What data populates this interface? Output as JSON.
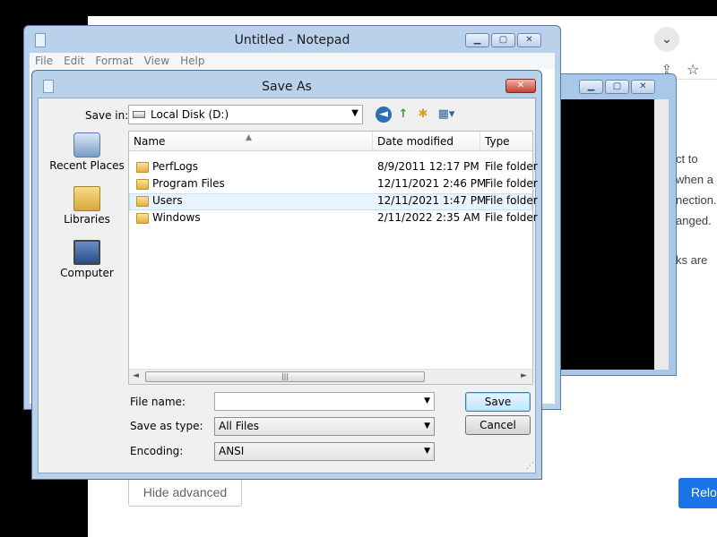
{
  "browser": {
    "download_icon": "⌄",
    "share_icon": "⇪",
    "star_icon": "☆",
    "side_text": [
      "ct to",
      "when a",
      "nection.",
      "anged.",
      "ks are"
    ],
    "hide_advanced": "Hide advanced",
    "reload": "Relo"
  },
  "notepad": {
    "title": "Untitled - Notepad",
    "menu": [
      "File",
      "Edit",
      "Format",
      "View",
      "Help"
    ],
    "controls": {
      "minimize": "▁",
      "maximize": "▢",
      "close": "✕"
    }
  },
  "window2": {
    "controls": {
      "minimize": "▁",
      "maximize": "▢",
      "close": "✕"
    }
  },
  "dialog": {
    "title": "Save As",
    "controls": {
      "close": "✕"
    },
    "save_in_label": "Save in:",
    "save_in_value": "Local Disk (D:)",
    "dropdown_arrow": "▼",
    "nav_icons": {
      "back": "◄",
      "up": "↑",
      "new_folder": "✱",
      "views": "▦▾"
    },
    "places": [
      {
        "label": "Recent Places",
        "icon": "recent-places-icon"
      },
      {
        "label": "Libraries",
        "icon": "libraries-icon"
      },
      {
        "label": "Computer",
        "icon": "computer-icon"
      }
    ],
    "columns": {
      "name": "Name",
      "date_modified": "Date modified",
      "type": "Type"
    },
    "sort_indicator": "▲",
    "files": [
      {
        "name": "PerfLogs",
        "date": "8/9/2011 12:17 PM",
        "type": "File folder"
      },
      {
        "name": "Program Files",
        "date": "12/11/2021 2:46 PM",
        "type": "File folder"
      },
      {
        "name": "Users",
        "date": "12/11/2021 1:47 PM",
        "type": "File folder"
      },
      {
        "name": "Windows",
        "date": "2/11/2022 2:35 AM",
        "type": "File folder"
      }
    ],
    "hscroll": {
      "left": "◄",
      "right": "►",
      "grip": "|||"
    },
    "file_name_label": "File name:",
    "file_name_value": "",
    "save_as_type_label": "Save as type:",
    "save_as_type_value": "All Files",
    "encoding_label": "Encoding:",
    "encoding_value": "ANSI",
    "save_button": "Save",
    "cancel_button": "Cancel",
    "resize_grip": "⋰"
  }
}
